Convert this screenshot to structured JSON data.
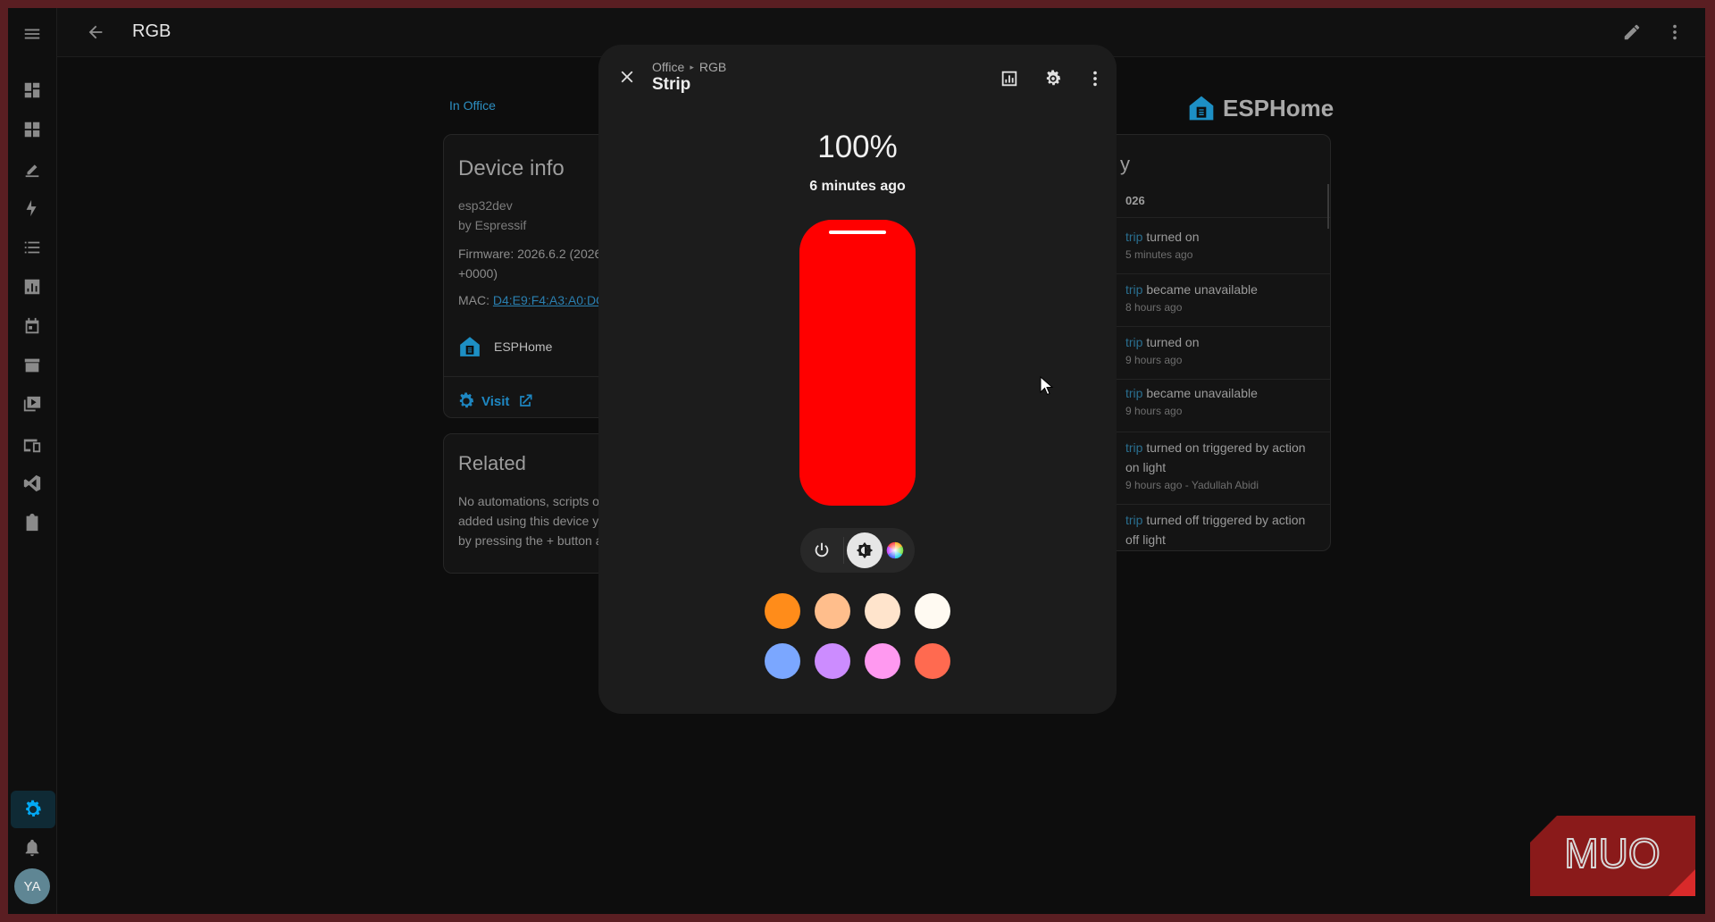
{
  "topbar": {
    "title": "RGB"
  },
  "sidebar": {
    "items": [
      "overview-icon",
      "dashboard-icon",
      "logbook-icon",
      "energy-icon",
      "todo-icon",
      "history-icon",
      "calendar-icon",
      "hacs-icon",
      "media-icon",
      "devices-icon",
      "vscode-icon",
      "clipboard-icon"
    ],
    "avatar_initials": "YA"
  },
  "page": {
    "area_link": "In Office",
    "device_info": {
      "title": "Device info",
      "model": "esp32dev",
      "manufacturer": "by Espressif",
      "firmware": "Firmware: 2026.6.2 (2026",
      "firmware_tz": "+0000)",
      "mac_label": "MAC: ",
      "mac_value": "D4:E9:F4:A3:A0:DC",
      "integration": "ESPHome",
      "visit_label": "Visit"
    },
    "related": {
      "title": "Related",
      "line1": "No automations, scripts o",
      "line2": "added using this device y",
      "line3": "by pressing the + button a"
    },
    "brand": "ESPHome",
    "logbook": {
      "title": "y",
      "date": "026",
      "entries": [
        {
          "entity": "trip",
          "text": " turned on",
          "line2": "",
          "time": "5 minutes ago"
        },
        {
          "entity": "trip",
          "text": " became unavailable",
          "line2": "",
          "time": "8 hours ago"
        },
        {
          "entity": "trip",
          "text": " turned on",
          "line2": "",
          "time": "9 hours ago"
        },
        {
          "entity": "trip",
          "text": " became unavailable",
          "line2": "",
          "time": "9 hours ago"
        },
        {
          "entity": "trip",
          "text": " turned on triggered by action",
          "line2": "on light",
          "time": "9 hours ago - Yadullah Abidi"
        },
        {
          "entity": "trip",
          "text": " turned off triggered by action",
          "line2": "off light",
          "time": ""
        }
      ]
    }
  },
  "dialog": {
    "breadcrumb": [
      "Office",
      "RGB"
    ],
    "title": "Strip",
    "brightness_label": "100%",
    "brightness_value": 100,
    "last_changed": "6 minutes ago",
    "light_color": "#ff0000",
    "modes": [
      "power-icon",
      "brightness-icon",
      "color-wheel-icon"
    ],
    "active_mode": "brightness-icon",
    "favorite_colors": [
      "#ff8c1a",
      "#ffbe8c",
      "#ffe4cc",
      "#fffaf2",
      "#7ba7ff",
      "#cc8cff",
      "#ff99f0",
      "#ff6a50"
    ]
  },
  "watermark": "MUO"
}
